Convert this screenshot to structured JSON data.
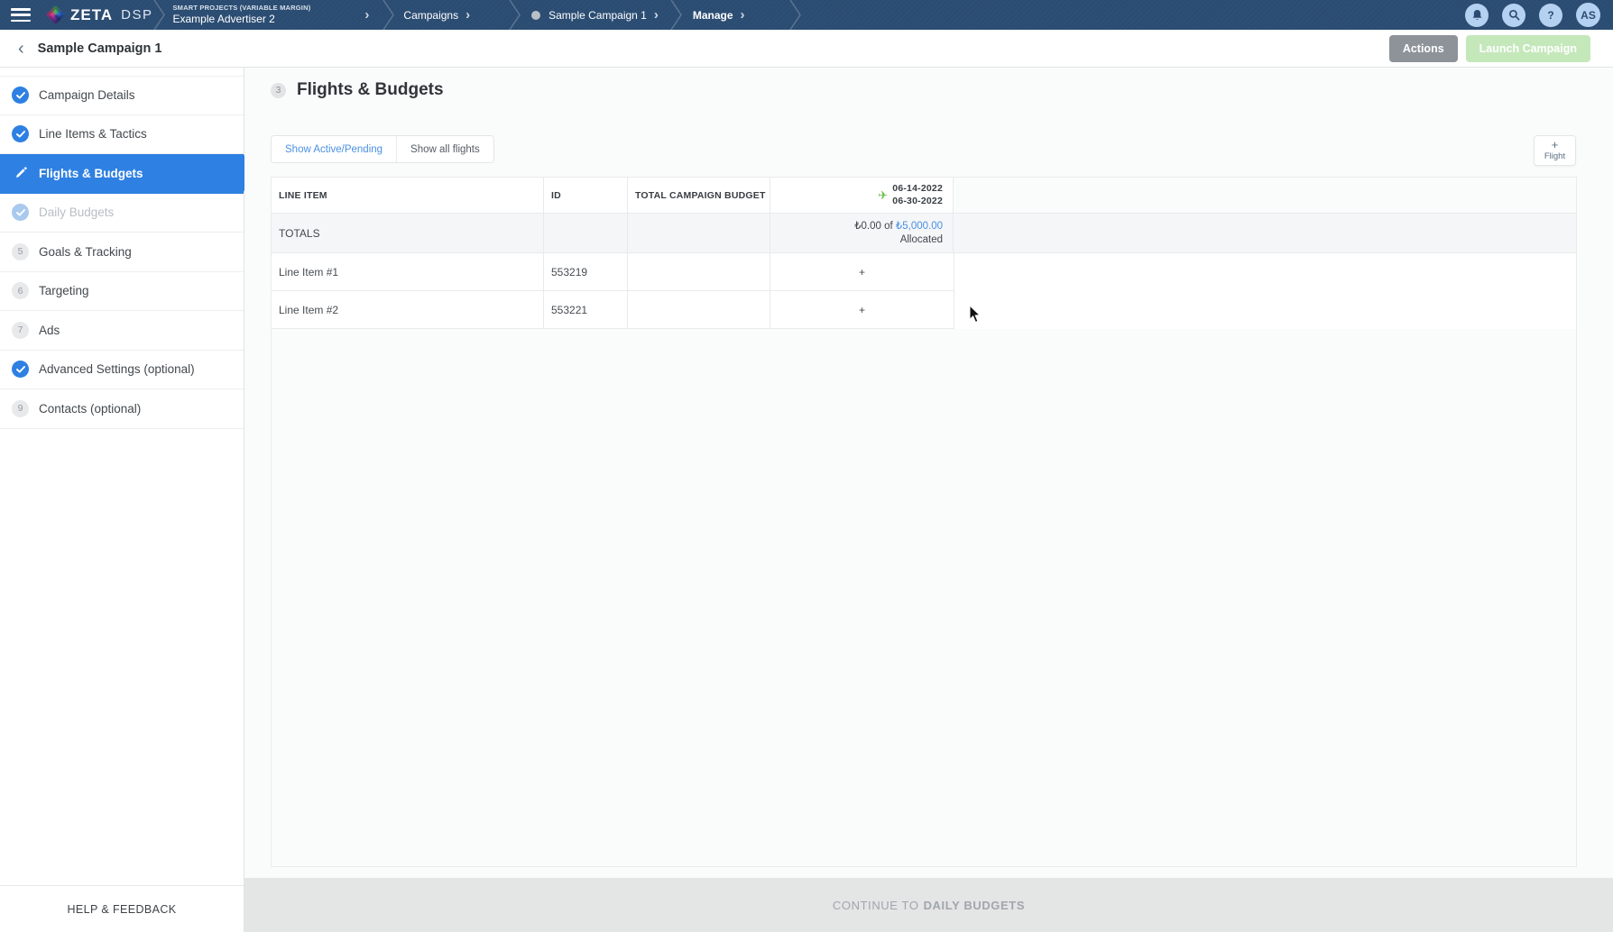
{
  "topbar": {
    "logo": {
      "brand": "ZETA",
      "suffix": "DSP"
    },
    "breadcrumbs": {
      "advertiser_super": "SMART PROJECTS (VARIABLE MARGIN)",
      "advertiser": "Example Advertiser 2",
      "campaigns": "Campaigns",
      "campaign": "Sample Campaign 1",
      "manage": "Manage",
      "chevron": "›"
    },
    "icons": {
      "help_glyph": "?",
      "avatar": "AS"
    }
  },
  "header": {
    "back_glyph": "‹",
    "title": "Sample Campaign 1",
    "actions_label": "Actions",
    "launch_label": "Launch Campaign"
  },
  "sidebar": {
    "items": [
      {
        "label": "Campaign Details"
      },
      {
        "label": "Line Items & Tactics"
      },
      {
        "label": "Flights & Budgets"
      },
      {
        "label": "Daily Budgets"
      },
      {
        "label": "Goals & Tracking",
        "num": "5"
      },
      {
        "label": "Targeting",
        "num": "6"
      },
      {
        "label": "Ads",
        "num": "7"
      },
      {
        "label": "Advanced Settings (optional)"
      },
      {
        "label": "Contacts (optional)",
        "num": "9"
      }
    ],
    "help_label": "HELP & FEEDBACK"
  },
  "main": {
    "step_number": "3",
    "title": "Flights & Budgets",
    "filters": {
      "active_label": "Show Active/Pending",
      "all_label": "Show all flights"
    },
    "flight_button": {
      "plus": "+",
      "label": "Flight"
    },
    "table": {
      "columns": {
        "line_item": "LINE ITEM",
        "id": "ID",
        "budget": "TOTAL CAMPAIGN BUDGET"
      },
      "flight_date_start": "06-14-2022",
      "flight_date_end": "06-30-2022",
      "totals": {
        "label": "TOTALS",
        "spent": "₺0.00 of",
        "budget": "₺5,000.00",
        "suffix": "Allocated"
      },
      "rows": [
        {
          "line_item": "Line Item #1",
          "id": "553219",
          "add": "+"
        },
        {
          "line_item": "Line Item #2",
          "id": "553221",
          "add": "+"
        }
      ]
    }
  },
  "footer": {
    "continue_prefix": "CONTINUE TO",
    "continue_target": "DAILY BUDGETS"
  },
  "colors": {
    "topbar": "#2b4c72",
    "accent_blue": "#2e80e2",
    "link_blue": "#4a90e2",
    "plane_green": "#6cc04a",
    "actions_gray": "#8d9399",
    "launch_green_disabled": "#c5e8bb"
  }
}
